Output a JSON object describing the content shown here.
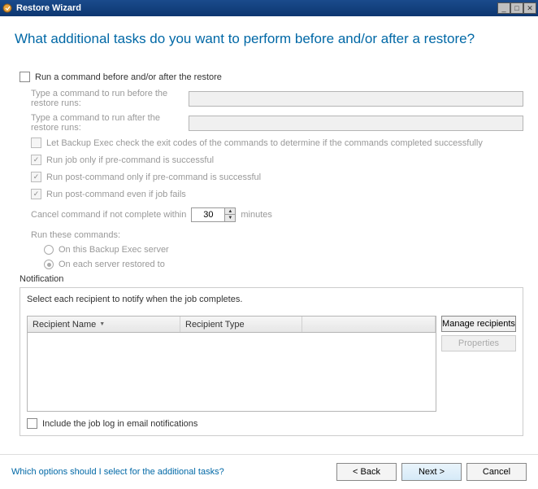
{
  "window": {
    "title": "Restore Wizard"
  },
  "page": {
    "heading": "What additional tasks do you want to perform before and/or after a restore?"
  },
  "commands": {
    "enable_label": "Run a command before and/or after the restore",
    "before_label": "Type a command to run before the restore runs:",
    "after_label": "Type a command to run after the restore runs:",
    "before_value": "",
    "after_value": "",
    "check_exit_label": "Let Backup Exec check the exit codes of the commands to determine if the commands completed successfully",
    "pre_success_label": "Run job only if pre-command is successful",
    "post_if_pre_label": "Run post-command only if pre-command is successful",
    "post_even_fail_label": "Run post-command even if job fails",
    "timeout_label": "Cancel command if not complete within",
    "timeout_value": "30",
    "timeout_unit": "minutes",
    "run_these_label": "Run these commands:",
    "radio_server_label": "On this Backup Exec server",
    "radio_each_label": "On each server restored to"
  },
  "notification": {
    "section_label": "Notification",
    "instruction": "Select each recipient to notify when the job completes.",
    "col_name": "Recipient Name",
    "col_type": "Recipient Type",
    "manage_btn": "Manage recipients",
    "properties_btn": "Properties",
    "include_log_label": "Include the job log in email notifications"
  },
  "footer": {
    "help_link": "Which options should I select for the additional tasks?",
    "back": "< Back",
    "next": "Next >",
    "cancel": "Cancel"
  }
}
